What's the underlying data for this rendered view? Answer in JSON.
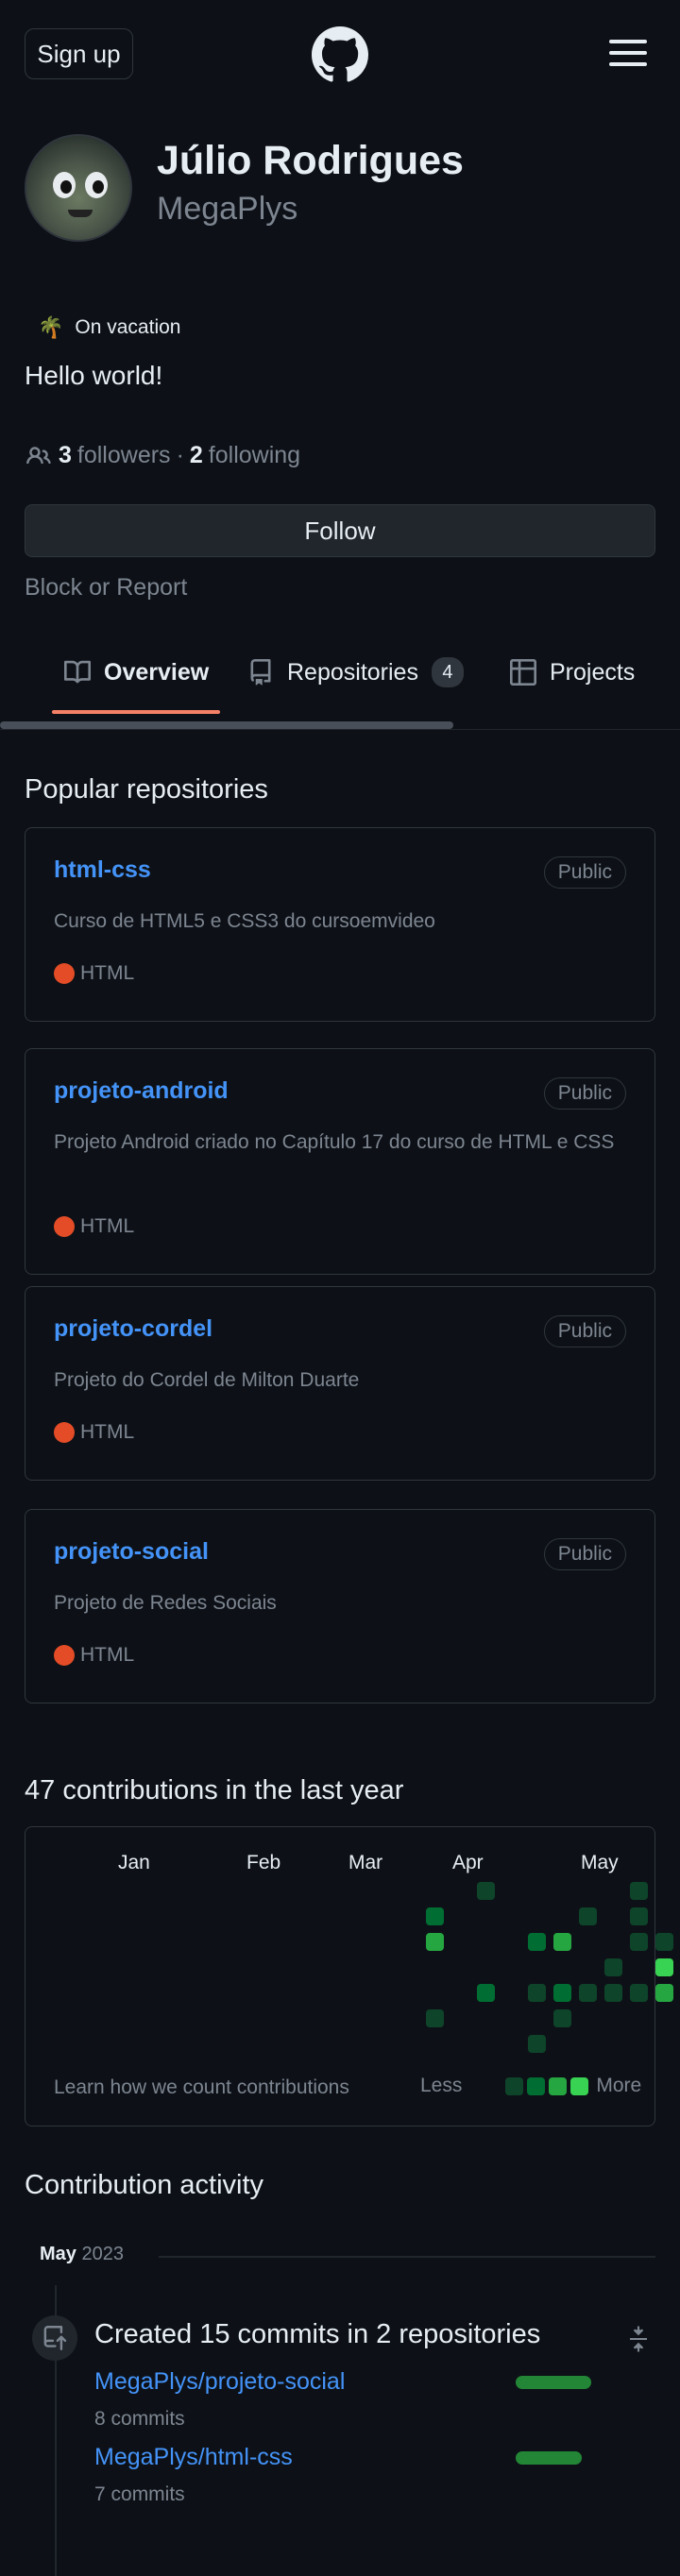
{
  "header": {
    "signup_label": "Sign up"
  },
  "profile": {
    "name": "Júlio Rodrigues",
    "username": "MegaPlys",
    "status": {
      "emoji": "🌴",
      "text": "On vacation"
    },
    "bio": "Hello world!",
    "followers_count": "3",
    "followers_label": "followers",
    "separator": "·",
    "following_count": "2",
    "following_label": "following",
    "follow_label": "Follow",
    "block_report": "Block or Report"
  },
  "tabs": [
    {
      "label": "Overview",
      "selected": true
    },
    {
      "label": "Repositories",
      "count": "4"
    },
    {
      "label": "Projects"
    }
  ],
  "popular": {
    "title": "Popular repositories",
    "repos": [
      {
        "name": "html-css",
        "visibility": "Public",
        "description": "Curso de HTML5 e CSS3 do cursoemvideo",
        "language": "HTML",
        "language_color": "#e34c26"
      },
      {
        "name": "projeto-android",
        "visibility": "Public",
        "description": "Projeto Android criado no Capítulo 17 do curso de HTML e CSS",
        "language": "HTML",
        "language_color": "#e34c26"
      },
      {
        "name": "projeto-cordel",
        "visibility": "Public",
        "description": "Projeto do Cordel de Milton Duarte",
        "language": "HTML",
        "language_color": "#e34c26"
      },
      {
        "name": "projeto-social",
        "visibility": "Public",
        "description": "Projeto de Redes Sociais",
        "language": "HTML",
        "language_color": "#e34c26"
      }
    ]
  },
  "contributions": {
    "title": "47 contributions in the last year",
    "months": [
      "Jan",
      "Feb",
      "Mar",
      "Apr",
      "May"
    ],
    "learn_link": "Learn how we count contributions",
    "legend_less": "Less",
    "legend_more": "More",
    "colors": [
      "#0e4429",
      "#006d32",
      "#26a641",
      "#39d353"
    ]
  },
  "activity": {
    "title": "Contribution activity",
    "month": "May",
    "year": "2023",
    "summary": "Created 15 commits in 2 repositories",
    "items": [
      {
        "repo": "MegaPlys/projeto-social",
        "commits": "8 commits"
      },
      {
        "repo": "MegaPlys/html-css",
        "commits": "7 commits"
      }
    ]
  }
}
